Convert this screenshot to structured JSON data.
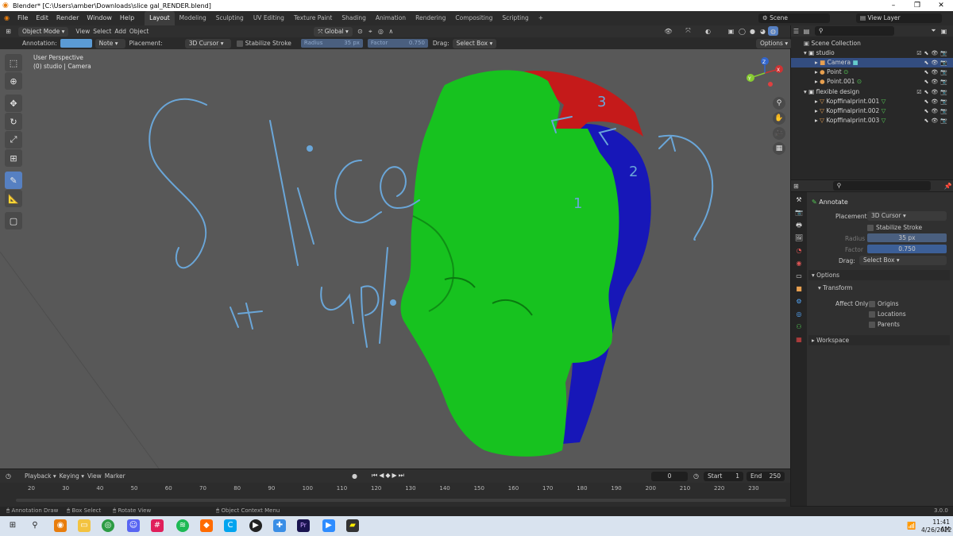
{
  "window": {
    "title": "Blender* [C:\\Users\\amber\\Downloads\\slice gal_RENDER.blend]",
    "controls": [
      "–",
      "❐",
      "✕"
    ]
  },
  "menubar": {
    "items": [
      "File",
      "Edit",
      "Render",
      "Window",
      "Help"
    ],
    "workspaces": [
      "Layout",
      "Modeling",
      "Sculpting",
      "UV Editing",
      "Texture Paint",
      "Shading",
      "Animation",
      "Rendering",
      "Compositing",
      "Scripting"
    ],
    "add_workspace": "+",
    "scene": "Scene",
    "view_layer": "View Layer"
  },
  "header": {
    "mode": "Object Mode",
    "menus": [
      "View",
      "Select",
      "Add",
      "Object"
    ],
    "orientation": "Global",
    "options": "Options"
  },
  "tool_settings": {
    "annotation_label": "Annotation:",
    "annotation_color": "#5b9bd5",
    "note": "Note",
    "placement_label": "Placement:",
    "placement": "3D Cursor",
    "stabilize": "Stabilize Stroke",
    "radius_label": "Radius",
    "radius_value": "35 px",
    "factor_label": "Factor",
    "factor_value": "0.750",
    "drag_label": "Drag:",
    "drag_value": "Select Box"
  },
  "viewport": {
    "perspective": "User Perspective",
    "collection": "(0) studio | Camera",
    "annotation_words": [
      "Slice",
      "it up!"
    ],
    "slice_numbers": [
      "1",
      "2",
      "3"
    ],
    "colors": {
      "green": "#17c21f",
      "red": "#c51a1a",
      "blue": "#1717b8",
      "annotation": "#6aa6d8",
      "background": "#585858"
    },
    "gizmo_axes": [
      "X",
      "Y",
      "Z"
    ]
  },
  "outliner": {
    "search_placeholder": "",
    "root": "Scene Collection",
    "collections": [
      {
        "name": "studio",
        "children": [
          "Camera",
          "Point",
          "Point.001"
        ]
      },
      {
        "name": "flexible design",
        "children": [
          "Kopffinalprint.001",
          "Kopffinalprint.002",
          "Kopffinalprint.003"
        ]
      }
    ]
  },
  "properties": {
    "tool_name": "Annotate",
    "placement_label": "Placement",
    "placement": "3D Cursor",
    "stabilize": "Stabilize Stroke",
    "radius_label": "Radius",
    "radius_value": "35 px",
    "factor_label": "Factor",
    "factor_value": "0.750",
    "drag_label": "Drag:",
    "drag_value": "Select Box",
    "options_panel": "Options",
    "transform_panel": "Transform",
    "affect_only": "Affect Only",
    "origins": "Origins",
    "locations": "Locations",
    "parents": "Parents",
    "workspace_panel": "Workspace"
  },
  "timeline": {
    "menus": [
      "Playback",
      "Keying",
      "View",
      "Marker"
    ],
    "current_frame": "0",
    "start_label": "Start",
    "start": "1",
    "end_label": "End",
    "end": "250",
    "ticks": [
      "20",
      "30",
      "40",
      "50",
      "60",
      "70",
      "80",
      "90",
      "100",
      "110",
      "120",
      "130",
      "140",
      "150",
      "160",
      "170",
      "180",
      "190",
      "200",
      "210",
      "220",
      "230"
    ]
  },
  "statusbar": {
    "items": [
      "Annotation Draw",
      "Box Select",
      "Rotate View",
      "Object Context Menu"
    ],
    "version": "3.0.0"
  },
  "taskbar": {
    "time": "11:41 AM",
    "date": "4/26/2022"
  }
}
